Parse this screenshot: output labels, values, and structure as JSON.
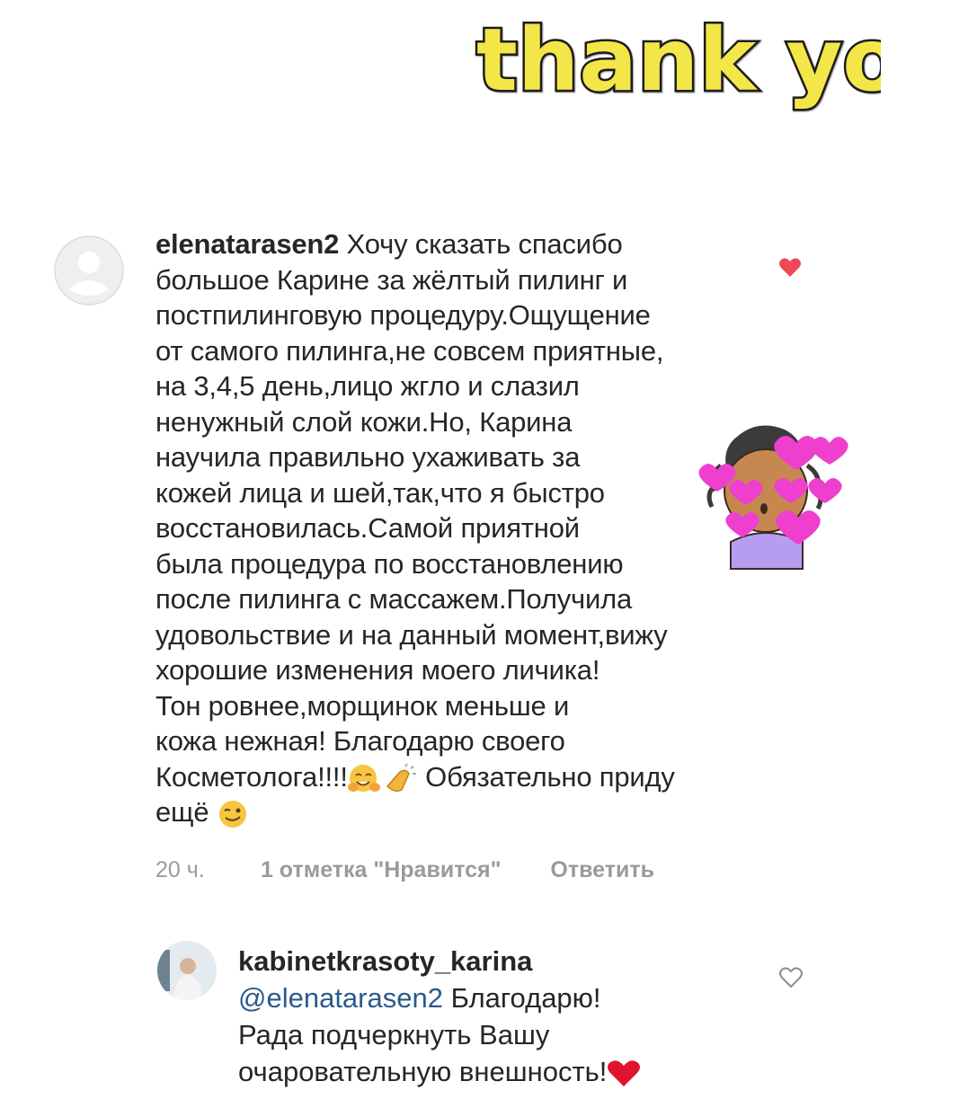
{
  "header": {
    "title": "thank you"
  },
  "comment": {
    "username": "elenatarasen2",
    "lines": [
      "Хочу сказать спасибо",
      "большое Карине за жёлтый пилинг и",
      "постпилинговую процедуру.Ощущение",
      "от самого пилинга,не совсем приятные,",
      "на 3,4,5 день,лицо жгло и слазил",
      "ненужный слой кожи.Но, Карина",
      "научила правильно ухаживать за",
      "кожей лица и шей,так,что я быстро",
      "восстановилась.Самой приятной",
      "была процедура по восстановлению",
      "после пилинга с массажем.Получила",
      "удовольствие и на данный момент,вижу",
      "хорошие изменения моего личика!",
      "Тон ровнее,морщинок меньше и",
      "кожа нежная! Благодарю своего",
      "Косметолога!!!!",
      "Обязательно приду",
      "ещё"
    ],
    "time": "20 ч.",
    "likes": "1 отметка \"Нравится\"",
    "reply_label": "Ответить",
    "like_color": "#ed4956"
  },
  "reply": {
    "username": "kabinetkrasoty_karina",
    "mention": "@elenatarasen2",
    "lines": [
      "Благодарю!",
      "Рада подчеркнуть Вашу",
      "очаровательную внешность!"
    ]
  },
  "icons": {
    "liked": "heart-filled-icon",
    "unliked": "heart-outline-icon",
    "avatar_default": "default-avatar-icon"
  }
}
